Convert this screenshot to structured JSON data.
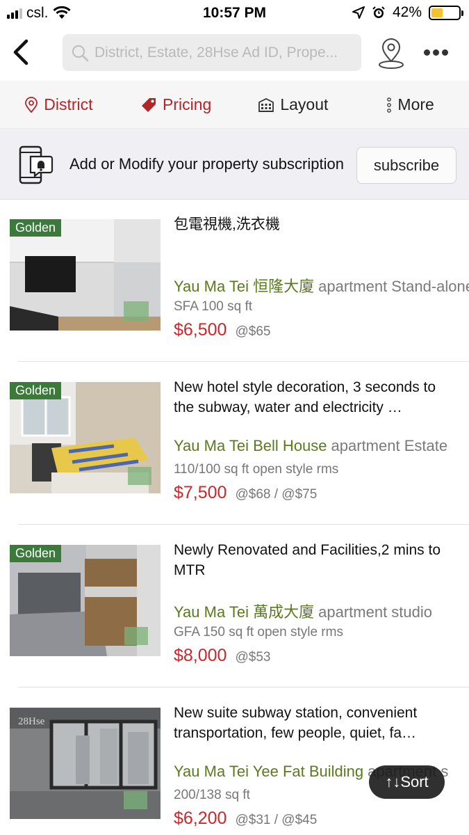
{
  "status": {
    "carrier": "csl.",
    "time": "10:57 PM",
    "battery": "42%",
    "battery_level": 0.42
  },
  "search": {
    "placeholder": "District, Estate, 28Hse Ad ID, Prope..."
  },
  "filters": [
    {
      "label": "District",
      "icon": "location-pin-icon"
    },
    {
      "label": "Pricing",
      "icon": "price-tag-icon"
    },
    {
      "label": "Layout",
      "icon": "building-icon"
    },
    {
      "label": "More",
      "icon": "vertical-dots-icon"
    }
  ],
  "subscribe": {
    "text": "Add or Modify your property subscription",
    "button": "subscribe"
  },
  "listings": [
    {
      "badge": "Golden",
      "title": "包電視機,洗衣機",
      "place": "Yau Ma Tei 恒隆大廈",
      "ptype": "apartment Stand-alone",
      "size": "SFA 100 sq ft",
      "price": "$6,500",
      "unit_price": "@$65"
    },
    {
      "badge": "Golden",
      "title": "New hotel style decoration, 3 seconds to the subway, water and electricity …",
      "place": "Yau Ma Tei Bell House",
      "ptype": "apartment Estate",
      "size": "110/100 sq ft open style rms",
      "price": "$7,500",
      "unit_price": "@$68 / @$75"
    },
    {
      "badge": "Golden",
      "title": "Newly Renovated and Facilities,2 mins to MTR",
      "place": "Yau Ma Tei 萬成大廈",
      "ptype": "apartment studio",
      "size": "GFA 150 sq ft open style rms",
      "price": "$8,000",
      "unit_price": "@$53"
    },
    {
      "badge": "",
      "watermark": "28Hse",
      "title": "New suite subway station, convenient transportation, few people, quiet, fa…",
      "place": "Yau Ma Tei Yee Fat Building",
      "ptype": "apartment s",
      "size": "200/138 sq ft",
      "price": "$6,200",
      "unit_price": "@$31 / @$45"
    }
  ],
  "sort": {
    "label": "↑↓Sort"
  },
  "colors": {
    "accent_red": "#b0262a",
    "price_red": "#d0262b",
    "place_green": "#5a7a1e",
    "badge_green": "#3b7a3b"
  }
}
